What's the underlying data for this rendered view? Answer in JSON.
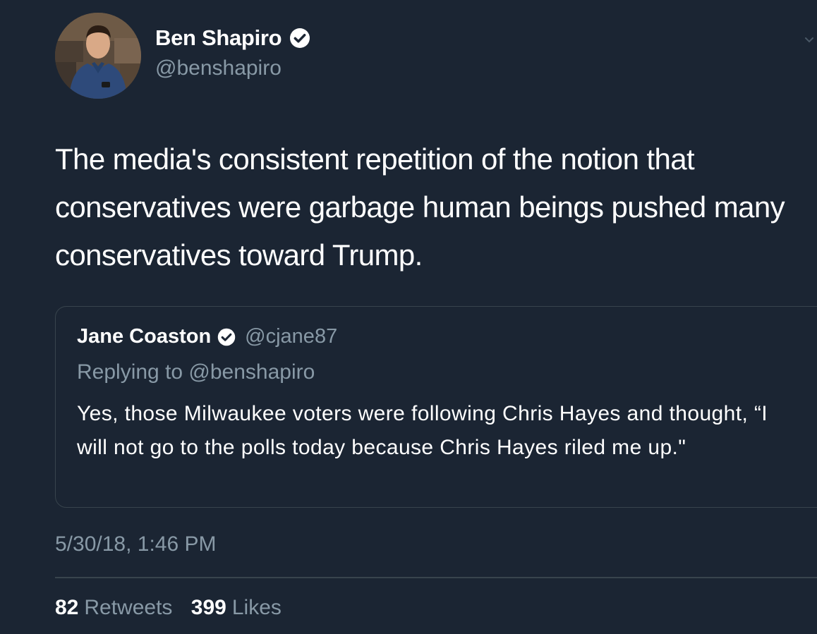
{
  "colors": {
    "background": "#1b2533",
    "secondary_text": "#8899a6",
    "border": "#38444d",
    "verified_badge": "#ffffff"
  },
  "tweet": {
    "author": {
      "name": "Ben Shapiro",
      "handle": "@benshapiro",
      "verified": true,
      "avatar_icon": "profile-photo"
    },
    "text": "The media's consistent repetition of the notion that conservatives were garbage human beings pushed many conservatives toward Trump.",
    "timestamp": "5/30/18, 1:46 PM",
    "stats": {
      "retweets_count": "82",
      "retweets_label": "Retweets",
      "likes_count": "399",
      "likes_label": "Likes"
    }
  },
  "quoted_tweet": {
    "author_name": "Jane Coaston",
    "author_handle": "@cjane87",
    "verified": true,
    "replying_to": "Replying to @benshapiro",
    "text": "Yes, those Milwaukee voters were following Chris Hayes and thought, “I will not go to the polls today because Chris Hayes riled me up.\""
  }
}
